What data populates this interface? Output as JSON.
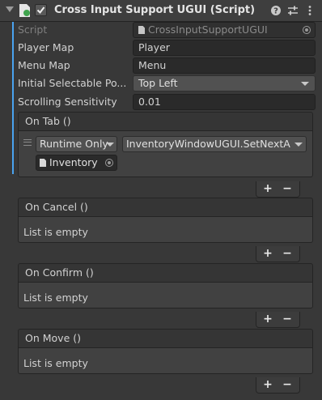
{
  "header": {
    "title": "Cross Input Support UGUI (Script)",
    "enabled": true,
    "help_icon": "help-icon",
    "preset_icon": "preset-sliders-icon",
    "menu_icon": "kebab-menu-icon"
  },
  "fields": {
    "script_label": "Script",
    "script_value": "CrossInputSupportUGUI",
    "player_map_label": "Player Map",
    "player_map_value": "Player",
    "menu_map_label": "Menu Map",
    "menu_map_value": "Menu",
    "initial_selectable_label": "Initial Selectable Po...",
    "initial_selectable_value": "Top Left",
    "scrolling_label": "Scrolling Sensitivity",
    "scrolling_value": "0.01"
  },
  "events": {
    "on_tab": {
      "title": "On Tab ()",
      "runtime_value": "Runtime Only",
      "function_value": "InventoryWindowUGUI.SetNextA",
      "object_value": "Inventory"
    },
    "on_cancel": {
      "title": "On Cancel ()",
      "empty_text": "List is empty"
    },
    "on_confirm": {
      "title": "On Confirm ()",
      "empty_text": "List is empty"
    },
    "on_move": {
      "title": "On Move ()",
      "empty_text": "List is empty"
    }
  },
  "buttons": {
    "plus": "+",
    "minus": "−"
  },
  "colors": {
    "accent_bar": "#4aa3f0",
    "background": "#383838"
  }
}
